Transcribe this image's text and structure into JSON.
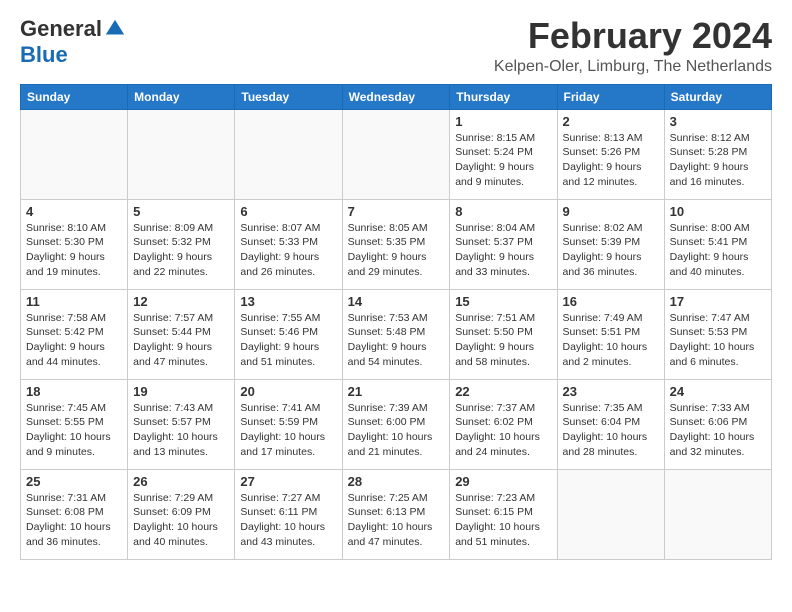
{
  "logo": {
    "general": "General",
    "blue": "Blue"
  },
  "title": "February 2024",
  "location": "Kelpen-Oler, Limburg, The Netherlands",
  "weekdays": [
    "Sunday",
    "Monday",
    "Tuesday",
    "Wednesday",
    "Thursday",
    "Friday",
    "Saturday"
  ],
  "weeks": [
    [
      {
        "day": "",
        "info": ""
      },
      {
        "day": "",
        "info": ""
      },
      {
        "day": "",
        "info": ""
      },
      {
        "day": "",
        "info": ""
      },
      {
        "day": "1",
        "info": "Sunrise: 8:15 AM\nSunset: 5:24 PM\nDaylight: 9 hours\nand 9 minutes."
      },
      {
        "day": "2",
        "info": "Sunrise: 8:13 AM\nSunset: 5:26 PM\nDaylight: 9 hours\nand 12 minutes."
      },
      {
        "day": "3",
        "info": "Sunrise: 8:12 AM\nSunset: 5:28 PM\nDaylight: 9 hours\nand 16 minutes."
      }
    ],
    [
      {
        "day": "4",
        "info": "Sunrise: 8:10 AM\nSunset: 5:30 PM\nDaylight: 9 hours\nand 19 minutes."
      },
      {
        "day": "5",
        "info": "Sunrise: 8:09 AM\nSunset: 5:32 PM\nDaylight: 9 hours\nand 22 minutes."
      },
      {
        "day": "6",
        "info": "Sunrise: 8:07 AM\nSunset: 5:33 PM\nDaylight: 9 hours\nand 26 minutes."
      },
      {
        "day": "7",
        "info": "Sunrise: 8:05 AM\nSunset: 5:35 PM\nDaylight: 9 hours\nand 29 minutes."
      },
      {
        "day": "8",
        "info": "Sunrise: 8:04 AM\nSunset: 5:37 PM\nDaylight: 9 hours\nand 33 minutes."
      },
      {
        "day": "9",
        "info": "Sunrise: 8:02 AM\nSunset: 5:39 PM\nDaylight: 9 hours\nand 36 minutes."
      },
      {
        "day": "10",
        "info": "Sunrise: 8:00 AM\nSunset: 5:41 PM\nDaylight: 9 hours\nand 40 minutes."
      }
    ],
    [
      {
        "day": "11",
        "info": "Sunrise: 7:58 AM\nSunset: 5:42 PM\nDaylight: 9 hours\nand 44 minutes."
      },
      {
        "day": "12",
        "info": "Sunrise: 7:57 AM\nSunset: 5:44 PM\nDaylight: 9 hours\nand 47 minutes."
      },
      {
        "day": "13",
        "info": "Sunrise: 7:55 AM\nSunset: 5:46 PM\nDaylight: 9 hours\nand 51 minutes."
      },
      {
        "day": "14",
        "info": "Sunrise: 7:53 AM\nSunset: 5:48 PM\nDaylight: 9 hours\nand 54 minutes."
      },
      {
        "day": "15",
        "info": "Sunrise: 7:51 AM\nSunset: 5:50 PM\nDaylight: 9 hours\nand 58 minutes."
      },
      {
        "day": "16",
        "info": "Sunrise: 7:49 AM\nSunset: 5:51 PM\nDaylight: 10 hours\nand 2 minutes."
      },
      {
        "day": "17",
        "info": "Sunrise: 7:47 AM\nSunset: 5:53 PM\nDaylight: 10 hours\nand 6 minutes."
      }
    ],
    [
      {
        "day": "18",
        "info": "Sunrise: 7:45 AM\nSunset: 5:55 PM\nDaylight: 10 hours\nand 9 minutes."
      },
      {
        "day": "19",
        "info": "Sunrise: 7:43 AM\nSunset: 5:57 PM\nDaylight: 10 hours\nand 13 minutes."
      },
      {
        "day": "20",
        "info": "Sunrise: 7:41 AM\nSunset: 5:59 PM\nDaylight: 10 hours\nand 17 minutes."
      },
      {
        "day": "21",
        "info": "Sunrise: 7:39 AM\nSunset: 6:00 PM\nDaylight: 10 hours\nand 21 minutes."
      },
      {
        "day": "22",
        "info": "Sunrise: 7:37 AM\nSunset: 6:02 PM\nDaylight: 10 hours\nand 24 minutes."
      },
      {
        "day": "23",
        "info": "Sunrise: 7:35 AM\nSunset: 6:04 PM\nDaylight: 10 hours\nand 28 minutes."
      },
      {
        "day": "24",
        "info": "Sunrise: 7:33 AM\nSunset: 6:06 PM\nDaylight: 10 hours\nand 32 minutes."
      }
    ],
    [
      {
        "day": "25",
        "info": "Sunrise: 7:31 AM\nSunset: 6:08 PM\nDaylight: 10 hours\nand 36 minutes."
      },
      {
        "day": "26",
        "info": "Sunrise: 7:29 AM\nSunset: 6:09 PM\nDaylight: 10 hours\nand 40 minutes."
      },
      {
        "day": "27",
        "info": "Sunrise: 7:27 AM\nSunset: 6:11 PM\nDaylight: 10 hours\nand 43 minutes."
      },
      {
        "day": "28",
        "info": "Sunrise: 7:25 AM\nSunset: 6:13 PM\nDaylight: 10 hours\nand 47 minutes."
      },
      {
        "day": "29",
        "info": "Sunrise: 7:23 AM\nSunset: 6:15 PM\nDaylight: 10 hours\nand 51 minutes."
      },
      {
        "day": "",
        "info": ""
      },
      {
        "day": "",
        "info": ""
      }
    ]
  ]
}
